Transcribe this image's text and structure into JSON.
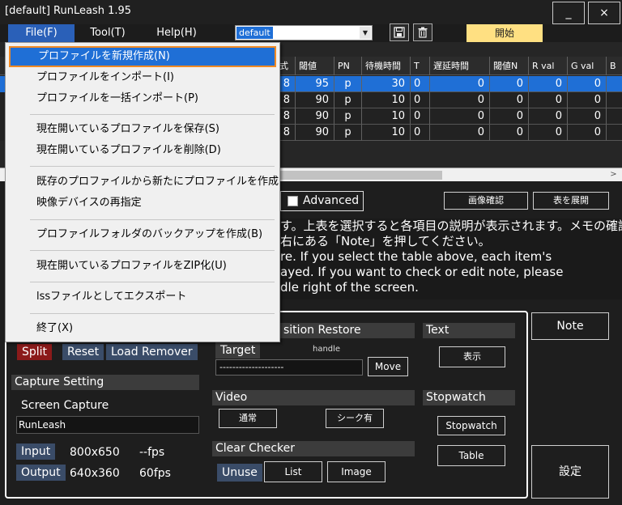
{
  "window": {
    "title": "[default] RunLeash 1.95",
    "minimize": "_",
    "close": "×"
  },
  "menubar": {
    "file": "File(F)",
    "tool": "Tool(T)",
    "help": "Help(H)"
  },
  "profile": {
    "selected": "default"
  },
  "toolbar": {
    "save_icon": "save-icon",
    "delete_icon": "trash-icon",
    "start": "開始"
  },
  "table": {
    "headers": [
      "式",
      "閾値",
      "PN",
      "待機時間",
      "T",
      "遅延時間",
      "閾値N",
      "R val",
      "G val",
      "B"
    ],
    "rows": [
      [
        "8",
        "95",
        "p",
        "30",
        "0",
        "0",
        "0",
        "0",
        "0"
      ],
      [
        "8",
        "90",
        "p",
        "10",
        "0",
        "0",
        "0",
        "0",
        "0"
      ],
      [
        "8",
        "90",
        "p",
        "10",
        "0",
        "0",
        "0",
        "0",
        "0"
      ],
      [
        "8",
        "90",
        "p",
        "10",
        "0",
        "0",
        "0",
        "0",
        "0"
      ]
    ],
    "selected_row": 0,
    "scroll_right": ">"
  },
  "controls": {
    "advanced": "Advanced",
    "image_check": "画像確認",
    "expand_table": "表を展開"
  },
  "description": {
    "lines": [
      "す。上表を選択すると各項目の説明が表示されます。メモの確認、",
      "右にある「Note」を押してください。",
      "re. If you select the table above, each item's",
      "ayed. If you want to check or edit note, please",
      "dle right of the screen."
    ]
  },
  "note_button": "Note",
  "settings_button": "設定",
  "split_group": {
    "split": "Split",
    "reset": "Reset",
    "load_remover": "Load Remover"
  },
  "capture": {
    "heading": "Capture Setting",
    "mode": "Screen Capture",
    "window": "RunLeash",
    "input_label": "Input",
    "input_res": "800x650",
    "input_fps": "--fps",
    "output_label": "Output",
    "output_res": "640x360",
    "output_fps": "60fps"
  },
  "position_restore": {
    "heading": "sition Restore",
    "target": "Target",
    "handle": "handle",
    "target_value": "--------------------",
    "move": "Move"
  },
  "video": {
    "heading": "Video",
    "normal": "通常",
    "seek": "シーク有"
  },
  "clear_checker": {
    "heading": "Clear Checker",
    "unuse": "Unuse",
    "list": "List",
    "image": "Image"
  },
  "text_group": {
    "heading": "Text",
    "show": "表示"
  },
  "stopwatch": {
    "heading": "Stopwatch",
    "stopwatch": "Stopwatch",
    "table": "Table"
  },
  "file_menu": {
    "items": [
      "プロファイルを新規作成(N)",
      "プロファイルをインポート(I)",
      "プロファイルを一括インポート(P)",
      "現在開いているプロファイルを保存(S)",
      "現在開いているプロファイルを削除(D)",
      "既存のプロファイルから新たにプロファイルを作成",
      "映像デバイスの再指定",
      "プロファイルフォルダのバックアップを作成(B)",
      "現在開いているプロファイルをZIP化(U)",
      "lssファイルとしてエクスポート",
      "終了(X)"
    ],
    "selected_index": 0
  },
  "colors": {
    "accent": "#1f6fd6",
    "start": "#ffe082",
    "split": "#8b1a1a",
    "highlight_border": "#f08a24"
  }
}
